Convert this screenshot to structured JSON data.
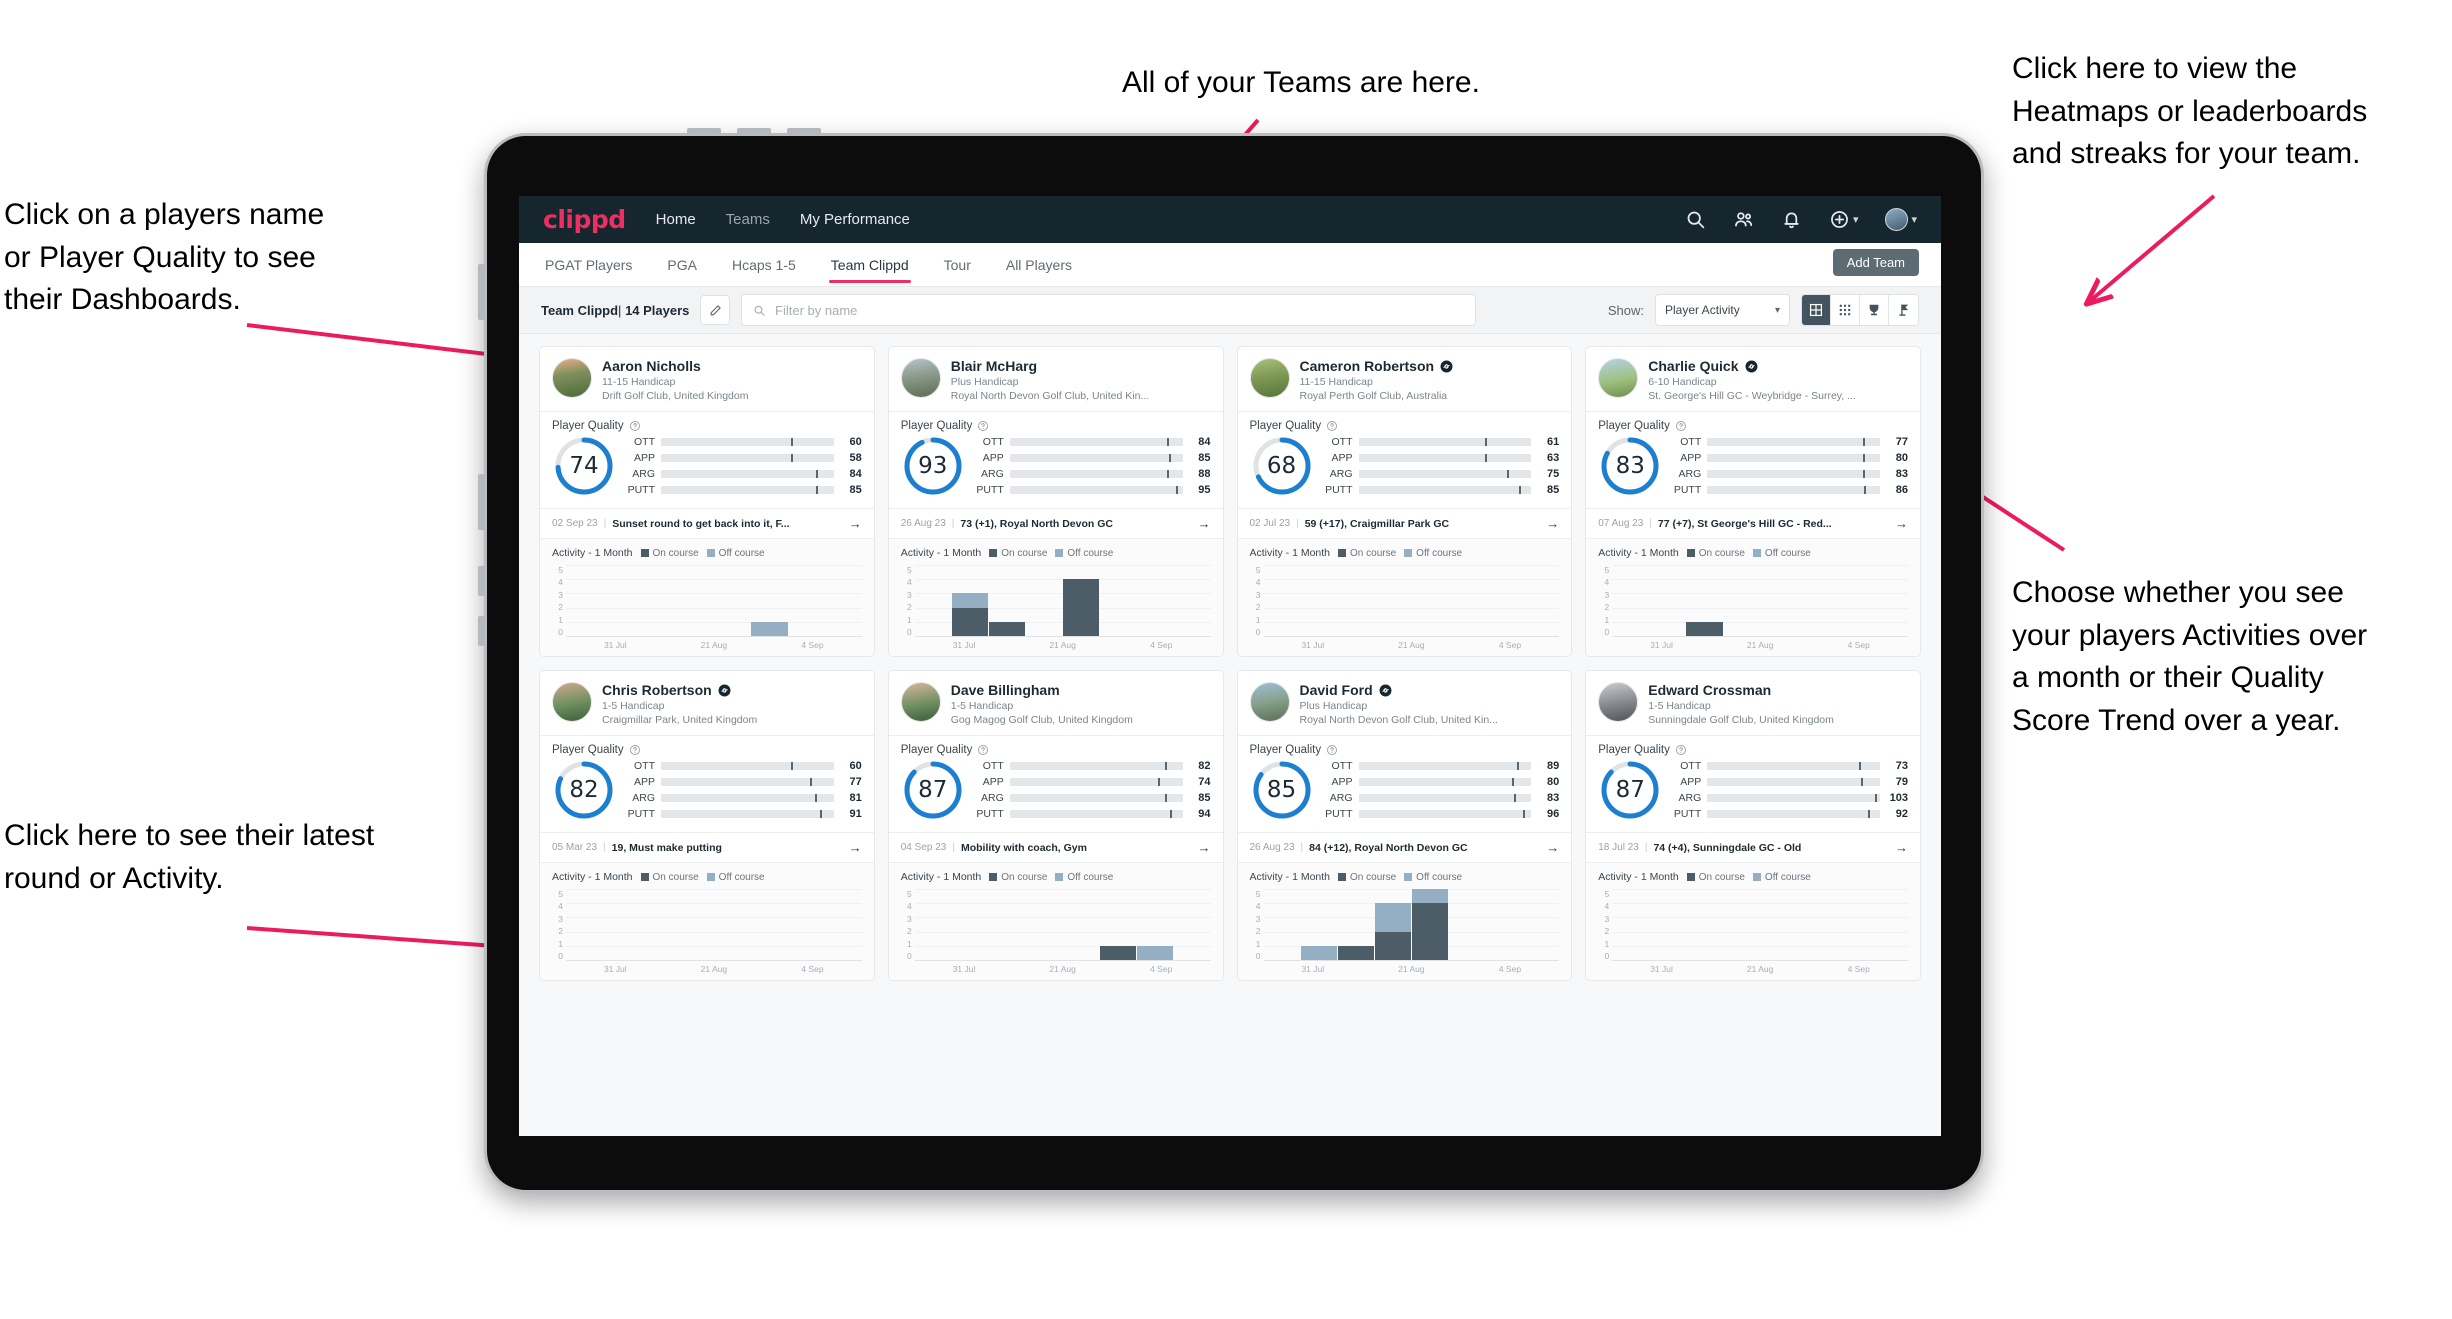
{
  "annotations": {
    "teams": "All of your Teams are here.",
    "heatmaps": "Click here to view the\nHeatmaps or leaderboards\nand streaks for your team.",
    "names": "Click on a players name\nor Player Quality to see\ntheir Dashboards.",
    "activity_choice": "Choose whether you see\nyour players Activities over\na month or their Quality\nScore Trend over a year.",
    "latest_round": "Click here to see their latest\nround or Activity."
  },
  "navbar": {
    "logo": "clippd",
    "links": [
      {
        "label": "Home",
        "active": true
      },
      {
        "label": "Teams",
        "active": false
      },
      {
        "label": "My Performance",
        "active": true
      }
    ],
    "icons": [
      "search-icon",
      "people-icon",
      "bell-icon",
      "add-circle-icon",
      "avatar"
    ],
    "brand_color": "#ef2d61",
    "bg_color": "#16262f"
  },
  "tabs": [
    {
      "label": "PGAT Players",
      "active": false
    },
    {
      "label": "PGA",
      "active": false
    },
    {
      "label": "Hcaps 1-5",
      "active": false
    },
    {
      "label": "Team Clippd",
      "active": true
    },
    {
      "label": "Tour",
      "active": false
    },
    {
      "label": "All Players",
      "active": false
    }
  ],
  "add_team_button": "Add Team",
  "filterbar": {
    "team_name": "Team Clippd",
    "team_count": "14 Players",
    "separator": "|",
    "edit_icon": "pencil-icon",
    "search_placeholder": "Filter by name",
    "search_value": "",
    "show_label": "Show:",
    "show_value": "Player Activity",
    "view_toggles": [
      {
        "name": "grid-view-icon",
        "active": true
      },
      {
        "name": "compact-grid-icon",
        "active": false
      },
      {
        "name": "trophy-icon",
        "active": false
      },
      {
        "name": "flag-icon",
        "active": false
      }
    ]
  },
  "quality_section": {
    "title": "Player Quality",
    "help_icon": "help-circle-icon",
    "metric_labels": [
      "OTT",
      "APP",
      "ARG",
      "PUTT"
    ],
    "colors": {
      "ott": "#f5b114",
      "app": "#2ee0b0",
      "arg": "#f5175c",
      "putt": "#a316d0",
      "ring": "#1c7fd0",
      "track": "#e4e7ea"
    }
  },
  "activity_section": {
    "title": "Activity - 1 Month",
    "legend_on": "On course",
    "legend_off": "Off course",
    "y_ticks": [
      "5",
      "4",
      "3",
      "2",
      "1",
      "0"
    ],
    "x_ticks": [
      "31 Jul",
      "21 Aug",
      "4 Sep"
    ],
    "colors": {
      "on": "#4d5d67",
      "off": "#94afc4"
    }
  },
  "players": [
    {
      "name": "Aaron Nicholls",
      "verified": false,
      "handicap": "11-15 Handicap",
      "club": "Drift Golf Club, United Kingdom",
      "quality": 74,
      "metrics": [
        {
          "label": "OTT",
          "value": 60,
          "fill": 62,
          "tick": 75
        },
        {
          "label": "APP",
          "value": 58,
          "fill": 55,
          "tick": 75
        },
        {
          "label": "ARG",
          "value": 84,
          "fill": 84,
          "tick": 90
        },
        {
          "label": "PUTT",
          "value": 85,
          "fill": 84,
          "tick": 90
        }
      ],
      "round_date": "02 Sep 23",
      "round_text": "Sunset round to get back into it, F...",
      "activity": [
        {
          "on": 0,
          "off": 0
        },
        {
          "on": 0,
          "off": 0
        },
        {
          "on": 0,
          "off": 0
        },
        {
          "on": 0,
          "off": 0
        },
        {
          "on": 0,
          "off": 0
        },
        {
          "on": 0,
          "off": 1
        },
        {
          "on": 0,
          "off": 0
        },
        {
          "on": 0,
          "off": 0
        }
      ]
    },
    {
      "name": "Blair McHarg",
      "verified": false,
      "handicap": "Plus Handicap",
      "club": "Royal North Devon Golf Club, United Kin...",
      "quality": 93,
      "metrics": [
        {
          "label": "OTT",
          "value": 84,
          "fill": 84,
          "tick": 91
        },
        {
          "label": "APP",
          "value": 85,
          "fill": 86,
          "tick": 92
        },
        {
          "label": "ARG",
          "value": 88,
          "fill": 85,
          "tick": 91
        },
        {
          "label": "PUTT",
          "value": 95,
          "fill": 93,
          "tick": 96
        }
      ],
      "round_date": "26 Aug 23",
      "round_text": "73 (+1), Royal North Devon GC",
      "activity": [
        {
          "on": 0,
          "off": 0
        },
        {
          "on": 2,
          "off": 1
        },
        {
          "on": 1,
          "off": 0
        },
        {
          "on": 0,
          "off": 0
        },
        {
          "on": 4,
          "off": 0
        },
        {
          "on": 0,
          "off": 0
        },
        {
          "on": 0,
          "off": 0
        },
        {
          "on": 0,
          "off": 0
        }
      ]
    },
    {
      "name": "Cameron Robertson",
      "verified": true,
      "handicap": "11-15 Handicap",
      "club": "Royal Perth Golf Club, Australia",
      "quality": 68,
      "metrics": [
        {
          "label": "OTT",
          "value": 61,
          "fill": 60,
          "tick": 73
        },
        {
          "label": "APP",
          "value": 63,
          "fill": 55,
          "tick": 73
        },
        {
          "label": "ARG",
          "value": 75,
          "fill": 74,
          "tick": 86
        },
        {
          "label": "PUTT",
          "value": 85,
          "fill": 82,
          "tick": 93
        }
      ],
      "round_date": "02 Jul 23",
      "round_text": "59 (+17), Craigmillar Park GC",
      "activity": [
        {
          "on": 0,
          "off": 0
        },
        {
          "on": 0,
          "off": 0
        },
        {
          "on": 0,
          "off": 0
        },
        {
          "on": 0,
          "off": 0
        },
        {
          "on": 0,
          "off": 0
        },
        {
          "on": 0,
          "off": 0
        },
        {
          "on": 0,
          "off": 0
        },
        {
          "on": 0,
          "off": 0
        }
      ]
    },
    {
      "name": "Charlie Quick",
      "verified": true,
      "handicap": "6-10 Handicap",
      "club": "St. George's Hill GC - Weybridge - Surrey, ...",
      "quality": 83,
      "metrics": [
        {
          "label": "OTT",
          "value": 77,
          "fill": 77,
          "tick": 90
        },
        {
          "label": "APP",
          "value": 80,
          "fill": 78,
          "tick": 90
        },
        {
          "label": "ARG",
          "value": 83,
          "fill": 78,
          "tick": 90
        },
        {
          "label": "PUTT",
          "value": 86,
          "fill": 79,
          "tick": 91
        }
      ],
      "round_date": "07 Aug 23",
      "round_text": "77 (+7), St George's Hill GC - Red...",
      "activity": [
        {
          "on": 0,
          "off": 0
        },
        {
          "on": 0,
          "off": 0
        },
        {
          "on": 1,
          "off": 0
        },
        {
          "on": 0,
          "off": 0
        },
        {
          "on": 0,
          "off": 0
        },
        {
          "on": 0,
          "off": 0
        },
        {
          "on": 0,
          "off": 0
        },
        {
          "on": 0,
          "off": 0
        }
      ]
    },
    {
      "name": "Chris Robertson",
      "verified": true,
      "handicap": "1-5 Handicap",
      "club": "Craigmillar Park, United Kingdom",
      "quality": 82,
      "metrics": [
        {
          "label": "OTT",
          "value": 60,
          "fill": 62,
          "tick": 75
        },
        {
          "label": "APP",
          "value": 77,
          "fill": 75,
          "tick": 86
        },
        {
          "label": "ARG",
          "value": 81,
          "fill": 78,
          "tick": 89
        },
        {
          "label": "PUTT",
          "value": 91,
          "fill": 85,
          "tick": 92
        }
      ],
      "round_date": "05 Mar 23",
      "round_text": "19, Must make putting",
      "activity": [
        {
          "on": 0,
          "off": 0
        },
        {
          "on": 0,
          "off": 0
        },
        {
          "on": 0,
          "off": 0
        },
        {
          "on": 0,
          "off": 0
        },
        {
          "on": 0,
          "off": 0
        },
        {
          "on": 0,
          "off": 0
        },
        {
          "on": 0,
          "off": 0
        },
        {
          "on": 0,
          "off": 0
        }
      ]
    },
    {
      "name": "Dave Billingham",
      "verified": false,
      "handicap": "1-5 Handicap",
      "club": "Gog Magog Golf Club, United Kingdom",
      "quality": 87,
      "metrics": [
        {
          "label": "OTT",
          "value": 82,
          "fill": 82,
          "tick": 90
        },
        {
          "label": "APP",
          "value": 74,
          "fill": 73,
          "tick": 86
        },
        {
          "label": "ARG",
          "value": 85,
          "fill": 80,
          "tick": 90
        },
        {
          "label": "PUTT",
          "value": 94,
          "fill": 90,
          "tick": 93
        }
      ],
      "round_date": "04 Sep 23",
      "round_text": "Mobility with coach, Gym",
      "activity": [
        {
          "on": 0,
          "off": 0
        },
        {
          "on": 0,
          "off": 0
        },
        {
          "on": 0,
          "off": 0
        },
        {
          "on": 0,
          "off": 0
        },
        {
          "on": 0,
          "off": 0
        },
        {
          "on": 1,
          "off": 0
        },
        {
          "on": 0,
          "off": 1
        },
        {
          "on": 0,
          "off": 0
        }
      ]
    },
    {
      "name": "David Ford",
      "verified": true,
      "handicap": "Plus Handicap",
      "club": "Royal North Devon Golf Club, United Kin...",
      "quality": 85,
      "metrics": [
        {
          "label": "OTT",
          "value": 89,
          "fill": 85,
          "tick": 92
        },
        {
          "label": "APP",
          "value": 80,
          "fill": 78,
          "tick": 89
        },
        {
          "label": "ARG",
          "value": 83,
          "fill": 79,
          "tick": 90
        },
        {
          "label": "PUTT",
          "value": 96,
          "fill": 92,
          "tick": 95
        }
      ],
      "round_date": "26 Aug 23",
      "round_text": "84 (+12), Royal North Devon GC",
      "activity": [
        {
          "on": 0,
          "off": 0
        },
        {
          "on": 0,
          "off": 1
        },
        {
          "on": 1,
          "off": 0
        },
        {
          "on": 2,
          "off": 2
        },
        {
          "on": 4,
          "off": 1
        },
        {
          "on": 0,
          "off": 0
        },
        {
          "on": 0,
          "off": 0
        },
        {
          "on": 0,
          "off": 0
        }
      ]
    },
    {
      "name": "Edward Crossman",
      "verified": false,
      "handicap": "1-5 Handicap",
      "club": "Sunningdale Golf Club, United Kingdom",
      "quality": 87,
      "metrics": [
        {
          "label": "OTT",
          "value": 73,
          "fill": 72,
          "tick": 88
        },
        {
          "label": "APP",
          "value": 79,
          "fill": 76,
          "tick": 89
        },
        {
          "label": "ARG",
          "value": 103,
          "fill": 88,
          "tick": 97
        },
        {
          "label": "PUTT",
          "value": 92,
          "fill": 86,
          "tick": 93
        }
      ],
      "round_date": "18 Jul 23",
      "round_text": "74 (+4), Sunningdale GC - Old",
      "activity": [
        {
          "on": 0,
          "off": 0
        },
        {
          "on": 0,
          "off": 0
        },
        {
          "on": 0,
          "off": 0
        },
        {
          "on": 0,
          "off": 0
        },
        {
          "on": 0,
          "off": 0
        },
        {
          "on": 0,
          "off": 0
        },
        {
          "on": 0,
          "off": 0
        },
        {
          "on": 0,
          "off": 0
        }
      ]
    }
  ]
}
